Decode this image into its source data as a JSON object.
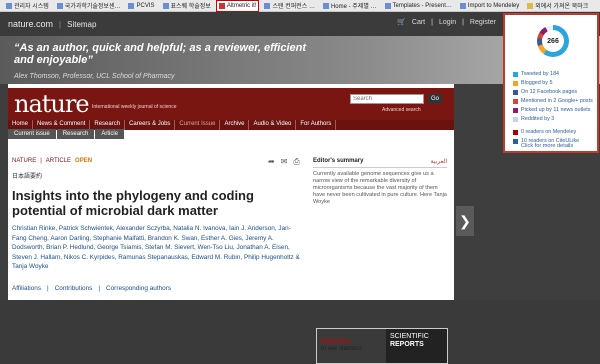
{
  "bookmarks": [
    {
      "label": "관리자 시스템"
    },
    {
      "label": "국가과학기술정보센…"
    },
    {
      "label": "PCVIS"
    },
    {
      "label": "표스퀘 학술정보"
    },
    {
      "label": "Altmetric it!"
    },
    {
      "label": "스탠 컨퍼런스 …"
    },
    {
      "label": "Home - 주제별 …"
    },
    {
      "label": "Templates - Present…"
    },
    {
      "label": "Import to Mendeley"
    },
    {
      "label": "외에서 가져온 북마크"
    }
  ],
  "header": {
    "site": "nature.com",
    "sitemap": "Sitemap",
    "cart": "Cart",
    "login": "Login",
    "register": "Register"
  },
  "banner": {
    "quote": "“As an author, quick and helpful; as a reviewer, efficient and enjoyable”",
    "attribution": "Alex Thomson, Professor, UCL School of Pharmacy"
  },
  "masthead": {
    "logo": "nature",
    "tagline": "International weekly journal of science",
    "search_placeholder": "Search",
    "go": "Go",
    "advanced": "Advanced search"
  },
  "nav": [
    "Home",
    "News & Comment",
    "Research",
    "Careers & Jobs",
    "Current Issue",
    "Archive",
    "Audio & Video",
    "For Authors"
  ],
  "breadcrumbs": [
    "Current issue",
    "Research",
    "Article"
  ],
  "article": {
    "journal": "NATURE",
    "type": "ARTICLE",
    "open": "OPEN",
    "japanese": "日本語要約",
    "title": "Insights into the phylogeny and coding potential of microbial dark matter",
    "authors": "Christian Rinke, Patrick Schwientek, Alexander Sczyrba, Natalia N. Ivanova, Iain J. Anderson, Jan-Fang Cheng, Aaron Darling, Stephanie Malfatti, Brandon K. Swan, Esther A. Gies, Jeremy A. Dodsworth, Brian P. Hedlund, George Tsiamis, Stefan M. Sievert, Wen-Tso Liu, Jonathan A. Eisen, Steven J. Hallam, Nikos C. Kyrpides, Ramunas Stepanauskas, Edward M. Rubin, Philip Hugenholtz & Tanja Woyke",
    "affiliations": "Affiliations",
    "contributions": "Contributions",
    "corresponding": "Corresponding authors"
  },
  "summary": {
    "heading": "Editor's summary",
    "arabic": "العربية",
    "text": "Currently available genome sequences give us a narrow view of the remarkable diversity of microorganisms because the vast majority of them have never been cultivated in pure culture. Here Tanja Woyke"
  },
  "ad": {
    "click": "Click here",
    "rest": "to see statistics",
    "brand1": "SCIENTIFIC",
    "brand2": "REPORTS"
  },
  "altmetric": {
    "score": "266",
    "stats": [
      {
        "label": "Tweeted by 184",
        "color": "#2aa6df"
      },
      {
        "label": "Blogged by 5",
        "color": "#f4a623"
      },
      {
        "label": "On 12 Facebook pages",
        "color": "#3b5998"
      },
      {
        "label": "Mentioned in 2 Google+ posts",
        "color": "#d6452f"
      },
      {
        "label": "Picked up by 11 news outlets",
        "color": "#8a1c6e"
      },
      {
        "label": "Reddited by 3",
        "color": "#c7d4e8"
      }
    ],
    "readers": [
      {
        "label": "0 readers on Mendeley",
        "color": "#a00"
      },
      {
        "label": "10 readers on CiteULike",
        "color": "#2a5fa0"
      }
    ],
    "more": "Click for more details"
  }
}
